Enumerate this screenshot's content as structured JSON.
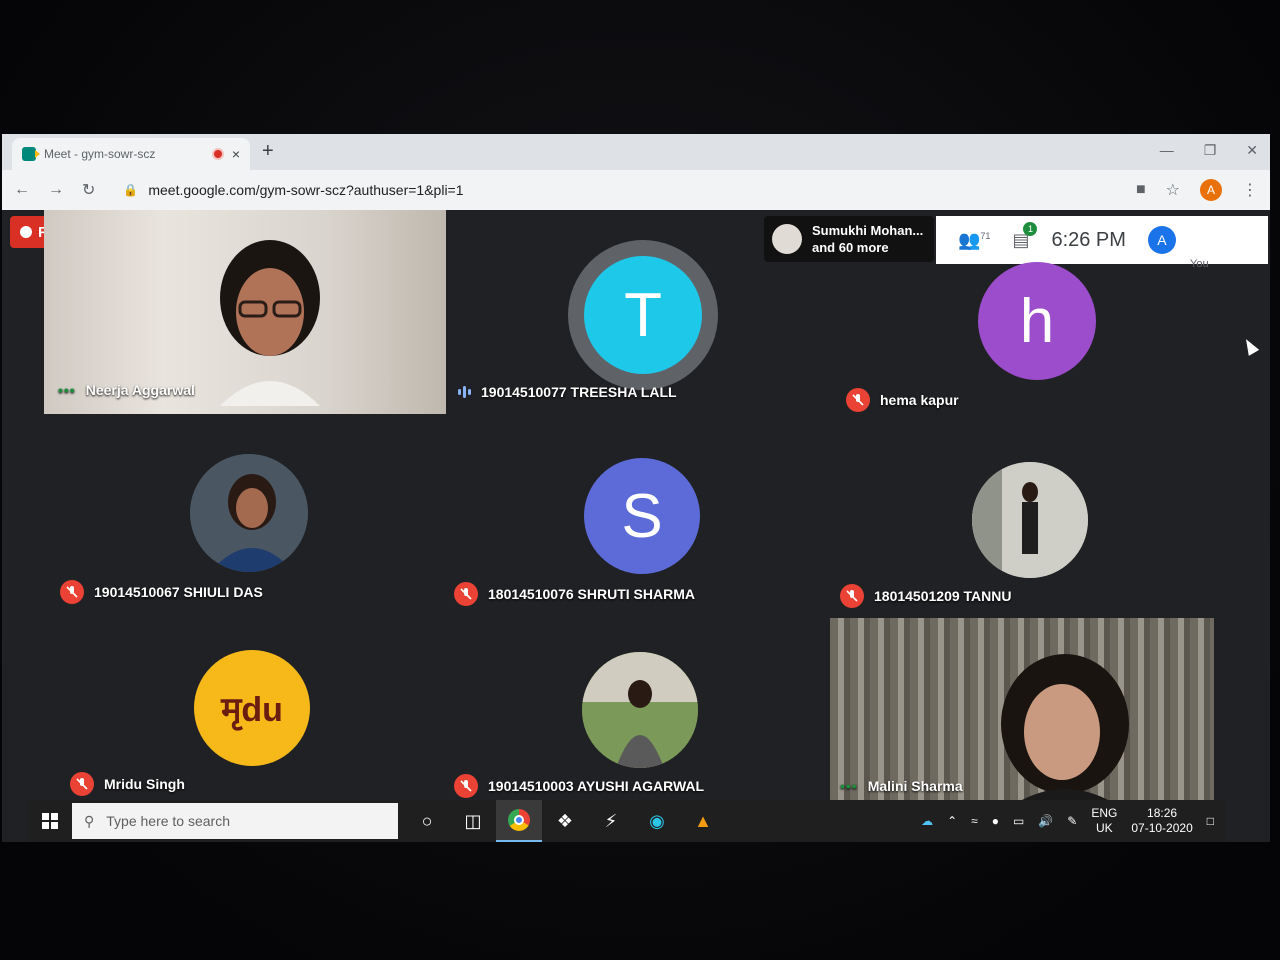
{
  "browser": {
    "tab_title": "Meet - gym-sowr-scz",
    "tab_close": "×",
    "new_tab": "+",
    "url": "meet.google.com/gym-sowr-scz?authuser=1&pli=1",
    "profile_initial": "A"
  },
  "meet": {
    "rec_label": "REC",
    "presenter_text_1": "Sumukhi Mohan...",
    "presenter_text_2": "and 60 more",
    "participant_count": "71",
    "chat_badge": "1",
    "time": "6:26 PM",
    "you_initial": "A",
    "you_label": "You",
    "participants": [
      {
        "name": "Neerja Aggarwal",
        "mode": "video"
      },
      {
        "name": "19014510077 TREESHA LALL",
        "initial": "T",
        "color": "#1ec8e8",
        "mode": "speaking"
      },
      {
        "name": "hema kapur",
        "initial": "h",
        "color": "#9c4dcc",
        "mode": "muted"
      },
      {
        "name": "19014510067 SHIULI DAS",
        "mode": "photo"
      },
      {
        "name": "18014510076 SHRUTI SHARMA",
        "initial": "S",
        "color": "#5c6bd8",
        "mode": "muted"
      },
      {
        "name": "18014501209 TANNU",
        "mode": "photo"
      },
      {
        "name": "Mridu Singh",
        "logo_text": "मृdu",
        "color": "#f7b81a",
        "mode": "muted"
      },
      {
        "name": "19014510003 AYUSHI AGARWAL",
        "mode": "photo"
      },
      {
        "name": "Malini Sharma",
        "mode": "video"
      }
    ]
  },
  "taskbar": {
    "search_placeholder": "Type here to search",
    "lang_1": "ENG",
    "lang_2": "UK",
    "clock_time": "18:26",
    "clock_date": "07-10-2020"
  }
}
